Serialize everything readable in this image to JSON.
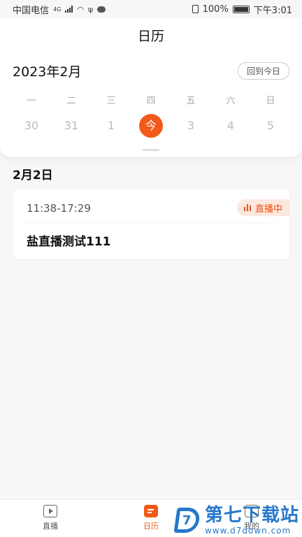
{
  "status_bar": {
    "carrier": "中国电信",
    "network": "4G",
    "battery": "100%",
    "time": "下午3:01"
  },
  "header": {
    "title": "日历"
  },
  "calendar": {
    "month_label": "2023年2月",
    "today_button": "回到今日",
    "weekdays": [
      "一",
      "二",
      "三",
      "四",
      "五",
      "六",
      "日"
    ],
    "dates": [
      "30",
      "31",
      "1",
      "今",
      "3",
      "4",
      "5"
    ],
    "selected_index": 3
  },
  "selected_day": {
    "label": "2月2日"
  },
  "events": [
    {
      "time": "11:38-17:29",
      "status": "直播中",
      "title": "盐直播测试111"
    }
  ],
  "tab_bar": {
    "tabs": [
      {
        "label": "直播",
        "icon": "play-icon"
      },
      {
        "label": "日历",
        "icon": "calendar-icon"
      },
      {
        "label": "我的",
        "icon": "user-icon"
      }
    ],
    "active_index": 1
  },
  "watermark": {
    "name": "第七下载站",
    "url": "www.d7down.com"
  },
  "colors": {
    "accent": "#f25a1a",
    "watermark": "#1f73c9"
  }
}
